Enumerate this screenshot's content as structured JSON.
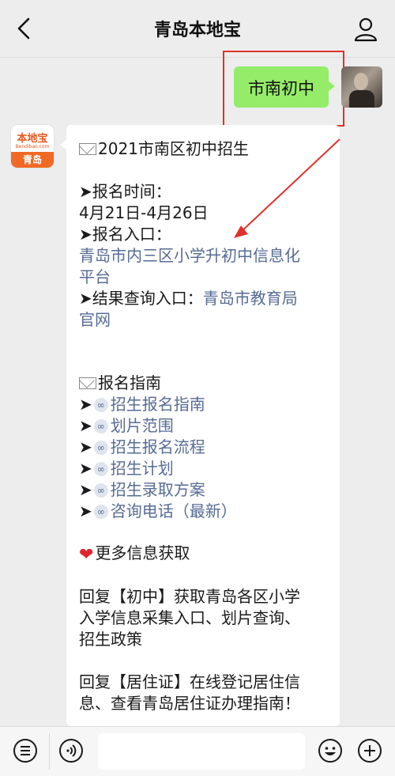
{
  "header": {
    "title": "青岛本地宝"
  },
  "sent_message": {
    "text": "市南初中"
  },
  "account": {
    "logo_top": "本地宝",
    "logo_sub": "Bendibao.com",
    "logo_bottom": "青岛"
  },
  "reply": {
    "headline": "2021市南区初中招生",
    "reg_time_label": "➤报名时间：",
    "reg_time_value": "4月21日-4月26日",
    "reg_entry_label": "➤报名入口：",
    "reg_entry_link_1": "青岛市内三区小学升初中信息化",
    "reg_entry_link_2": "平台",
    "result_label": "➤结果查询入口：",
    "result_link_1": "青岛市教育局",
    "result_link_2": "官网",
    "guide_title": "报名指南",
    "guide_items": [
      "招生报名指南",
      "划片范围",
      "招生报名流程",
      "招生计划",
      "招生录取方案",
      "咨询电话（最新）"
    ],
    "more_title": "更多信息获取",
    "reply1_lines": [
      "回复【初中】获取青岛各区小学",
      "入学信息采集入口、划片查询、",
      "招生政策"
    ],
    "reply2_lines": [
      "回复【居住证】在线登记居住信",
      "息、查看青岛居住证办理指南！"
    ]
  },
  "colors": {
    "link": "#576b95",
    "bubble_green": "#95ec69",
    "highlight_red": "#e0312b"
  },
  "icons": {
    "back": "chevron-left-icon",
    "profile": "user-icon",
    "menu": "menu-icon",
    "voice": "voice-icon",
    "emoji": "emoji-icon",
    "plus": "plus-icon"
  }
}
